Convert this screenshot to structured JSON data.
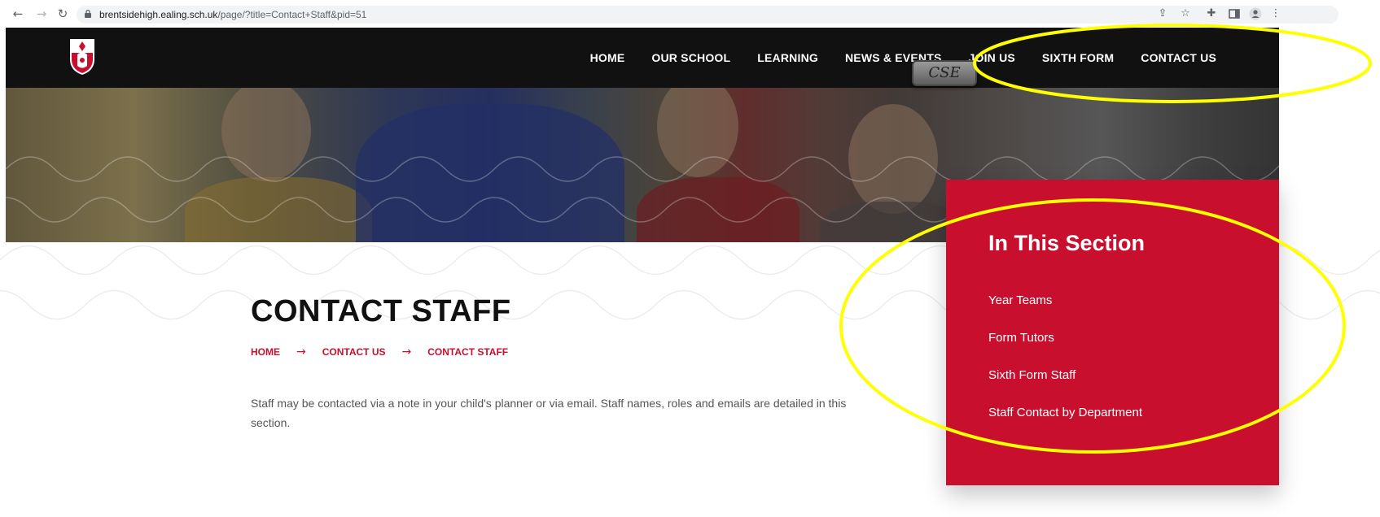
{
  "browser": {
    "url_host": "brentsidehigh.ealing.sch.uk",
    "url_path": "/page/?title=Contact+Staff&pid=51",
    "icons": [
      "back-arrow-icon",
      "forward-arrow-icon",
      "reload-icon",
      "lock-icon",
      "share-icon",
      "star-icon",
      "puzzle-icon",
      "side-panel-icon",
      "profile-icon",
      "menu-icon"
    ]
  },
  "header": {
    "nav": [
      "HOME",
      "OUR SCHOOL",
      "LEARNING",
      "NEWS & EVENTS",
      "JOIN US",
      "SIXTH FORM",
      "CONTACT US"
    ],
    "badge": "CSE"
  },
  "main": {
    "title": "CONTACT STAFF",
    "breadcrumb": [
      "HOME",
      "CONTACT US",
      "CONTACT STAFF"
    ],
    "intro": "Staff may be contacted via a note in your child's planner or via email.  Staff names, roles and emails are detailed in this section."
  },
  "sidebar": {
    "heading": "In This Section",
    "links": [
      "Year Teams",
      "Form Tutors",
      "Sixth Form Staff",
      "Staff Contact by Department"
    ]
  },
  "colors": {
    "brand_red": "#c8102e",
    "header_bg": "#111111",
    "annotation_yellow": "#ffff00"
  }
}
